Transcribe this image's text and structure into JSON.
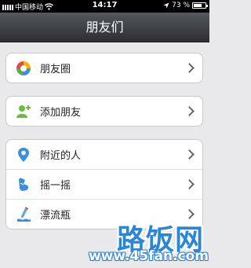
{
  "status_bar": {
    "carrier": "中国移动",
    "time": "14:17",
    "battery_percent": "73 %",
    "battery_level": 0.73,
    "icons": [
      "signal-icon",
      "wifi-icon",
      "location-arrow-icon",
      "battery-icon"
    ]
  },
  "nav": {
    "title": "朋友们"
  },
  "groups": [
    {
      "items": [
        {
          "label": "朋友圈",
          "icon": "moments-icon"
        }
      ]
    },
    {
      "items": [
        {
          "label": "添加朋友",
          "icon": "add-friend-icon"
        }
      ]
    },
    {
      "items": [
        {
          "label": "附近的人",
          "icon": "location-pin-icon"
        },
        {
          "label": "摇一摇",
          "icon": "shake-icon"
        },
        {
          "label": "漂流瓶",
          "icon": "bottle-icon"
        }
      ]
    }
  ],
  "watermark": {
    "logo": "路饭网",
    "url": "www.45fan.com"
  },
  "colors": {
    "nav_top": "#55585c",
    "nav_bottom": "#2c2e31",
    "background": "#e9e9eb",
    "watermark": "#2c86d6"
  }
}
